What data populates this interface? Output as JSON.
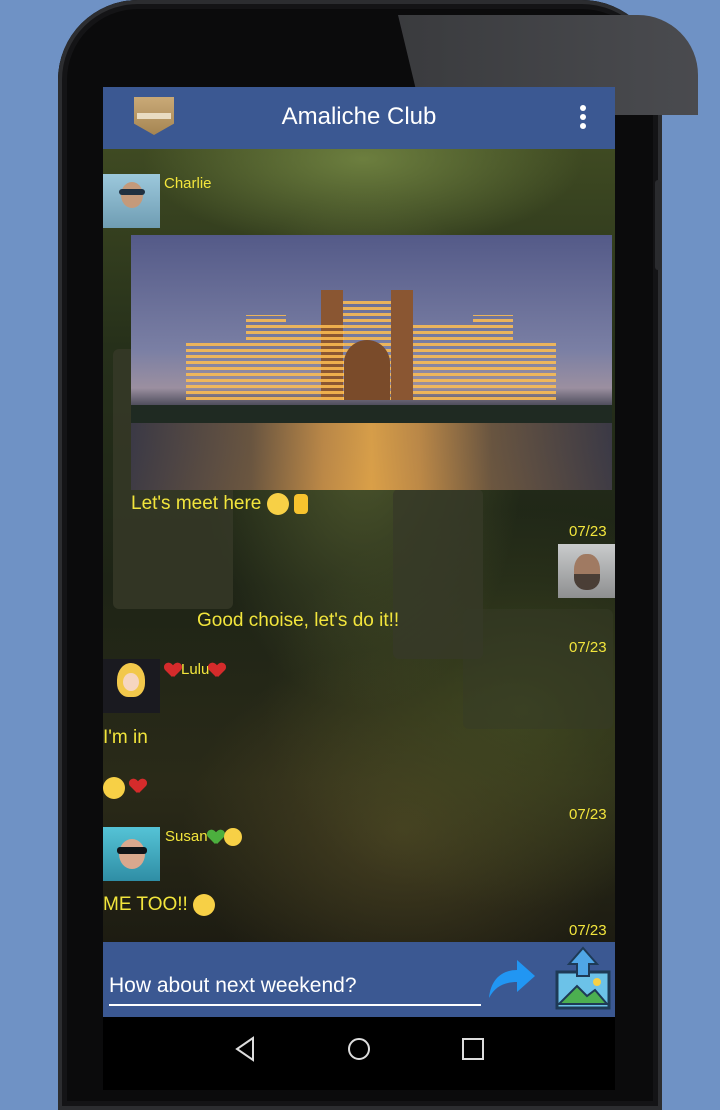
{
  "app": {
    "title": "Amaliche Club"
  },
  "messages": {
    "charlie_name": "Charlie",
    "charlie_text": "Let's meet here",
    "reply_text": "Good choise, let's do it!!",
    "reply_time": "07/23",
    "charlie_time": "07/23",
    "lulu_name": "Lulu",
    "lulu_text": "I'm in",
    "lulu_time": "07/23",
    "susan_name": "Susan",
    "susan_text": "ME TOO!!",
    "susan_time": "07/23"
  },
  "composer": {
    "value": "How about next weekend?"
  },
  "icons": {
    "menu": "more-vert-icon",
    "send": "send-arrow-icon",
    "upload": "image-upload-icon",
    "back": "nav-back-icon",
    "home": "nav-home-icon",
    "recents": "nav-recents-icon"
  },
  "colors": {
    "appbar": "#3b5892",
    "message_text": "#f2e53c",
    "background": "#6f92c5"
  }
}
